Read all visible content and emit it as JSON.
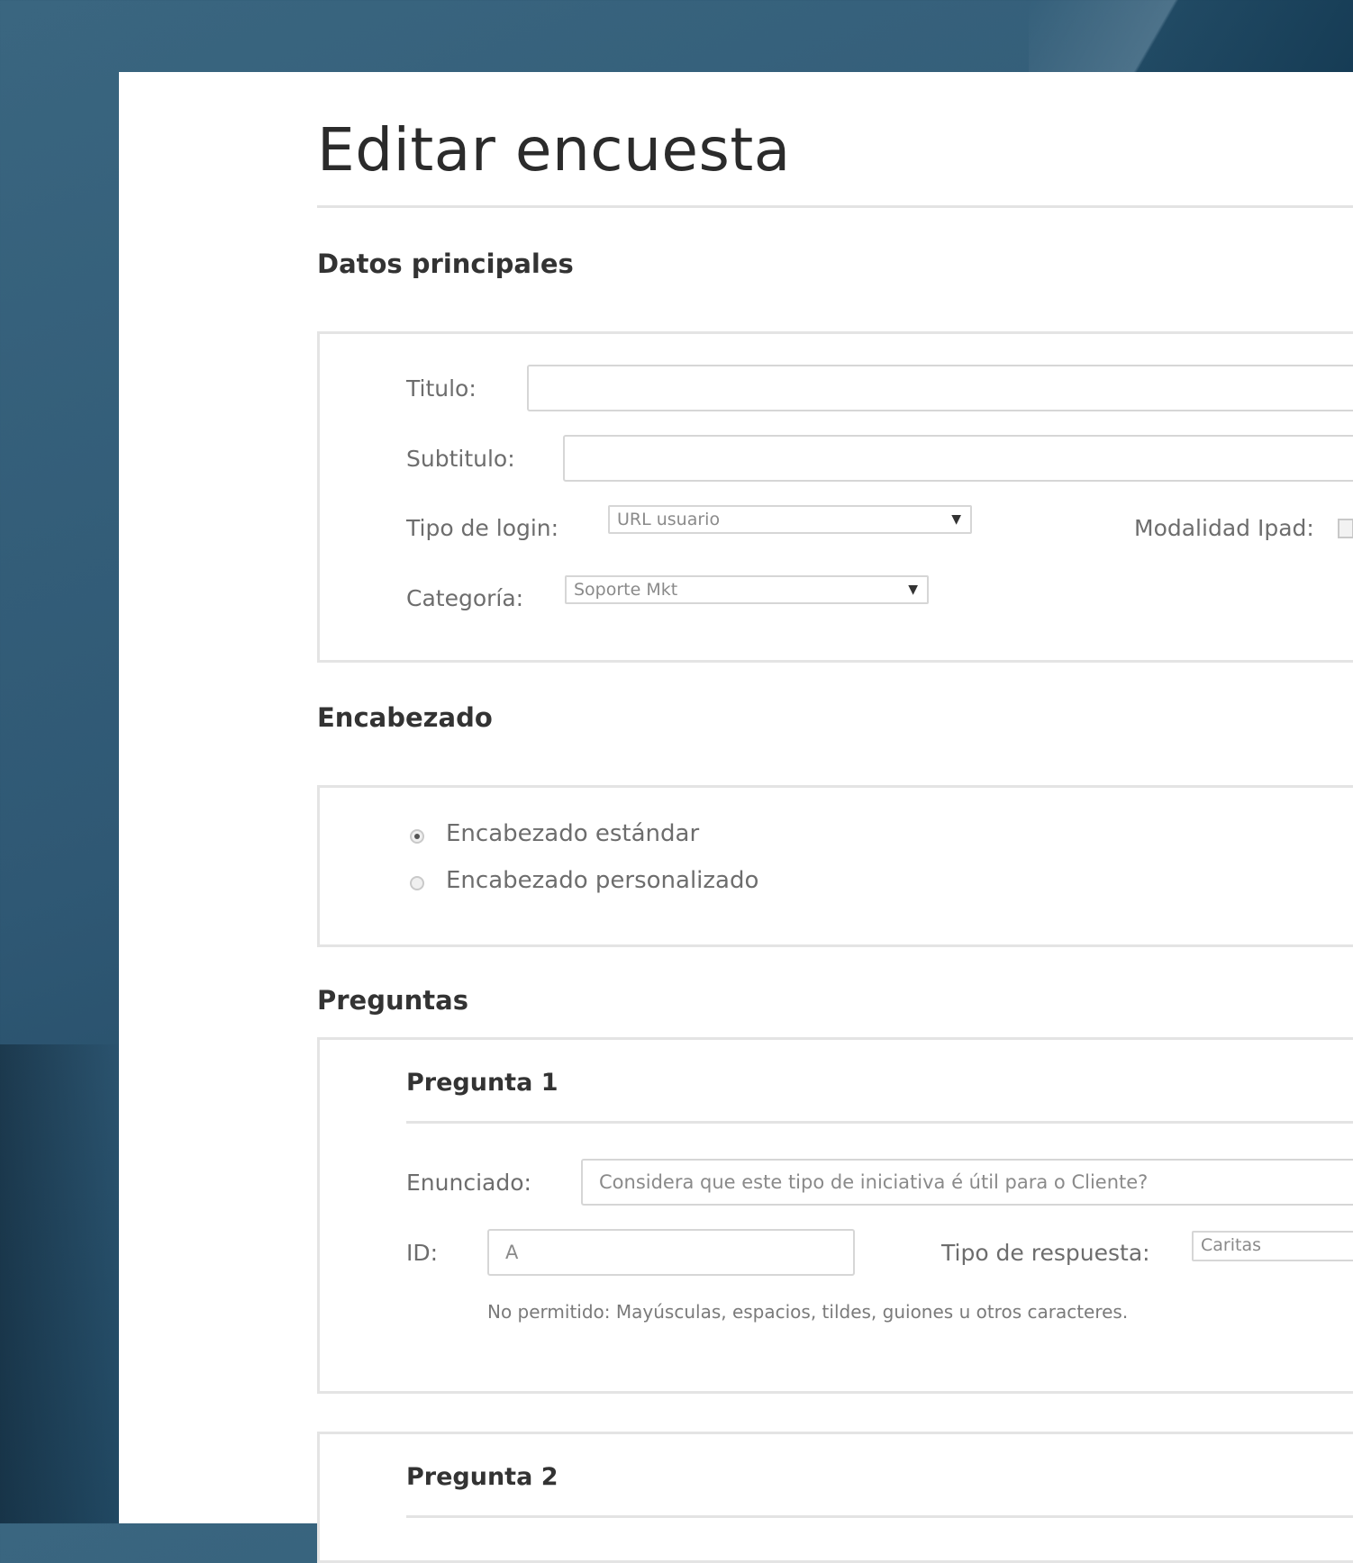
{
  "page": {
    "title": "Editar encuesta"
  },
  "datos_principales": {
    "heading": "Datos principales",
    "titulo_label": "Titulo:",
    "titulo_value": "",
    "subtitulo_label": "Subtitulo:",
    "subtitulo_value": "",
    "tipo_login_label": "Tipo de login:",
    "tipo_login_value": "URL usuario",
    "modalidad_label": "Modalidad Ipad:",
    "categoria_label": "Categoría:",
    "categoria_value": "Soporte Mkt"
  },
  "encabezado": {
    "heading": "Encabezado",
    "options": [
      {
        "label": "Encabezado estándar",
        "checked": true
      },
      {
        "label": "Encabezado personalizado",
        "checked": false
      }
    ]
  },
  "preguntas": {
    "heading": "Preguntas",
    "items": [
      {
        "heading": "Pregunta 1",
        "enunciado_label": "Enunciado:",
        "enunciado_value": "Considera que este tipo de iniciativa é útil para o Cliente?",
        "id_label": "ID:",
        "id_value": "A",
        "tipo_respuesta_label": "Tipo de respuesta:",
        "tipo_respuesta_value": "Caritas",
        "hint": "No permitido: Mayúsculas, espacios, tildes, guiones u otros caracteres."
      },
      {
        "heading": "Pregunta 2"
      }
    ]
  }
}
